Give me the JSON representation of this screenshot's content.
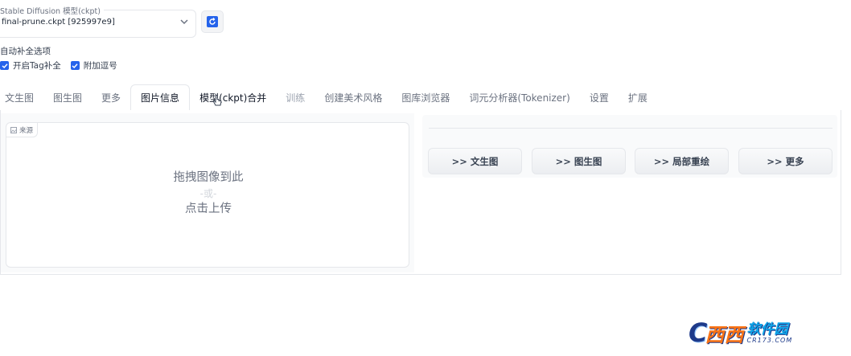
{
  "checkpoint": {
    "label": "Stable Diffusion 模型(ckpt)",
    "value": "final-prune.ckpt [925997e9]"
  },
  "autocomplete": {
    "title": "自动补全选项",
    "options": [
      {
        "label": "开启Tag补全",
        "checked": true
      },
      {
        "label": "附加逗号",
        "checked": true
      }
    ]
  },
  "tabs": [
    {
      "label": "文生图"
    },
    {
      "label": "图生图"
    },
    {
      "label": "更多"
    },
    {
      "label": "图片信息",
      "active": true
    },
    {
      "label": "模型(ckpt)合并"
    },
    {
      "label": "训练"
    },
    {
      "label": "创建美术风格"
    },
    {
      "label": "图库浏览器"
    },
    {
      "label": "词元分析器(Tokenizer)"
    },
    {
      "label": "设置"
    },
    {
      "label": "扩展"
    }
  ],
  "upload": {
    "source_label": "来源",
    "drop_text": "拖拽图像到此",
    "or_text": "-或-",
    "click_text": "点击上传"
  },
  "send_buttons": [
    {
      "label": ">> 文生图"
    },
    {
      "label": ">> 图生图"
    },
    {
      "label": ">> 局部重绘"
    },
    {
      "label": ">> 更多"
    }
  ],
  "watermark": {
    "main": "西西",
    "brand": "软件园",
    "domain": "CR173.COM"
  },
  "colors": {
    "accent": "#2563eb",
    "border": "#e5e7eb",
    "muted_text": "#6b7280"
  }
}
